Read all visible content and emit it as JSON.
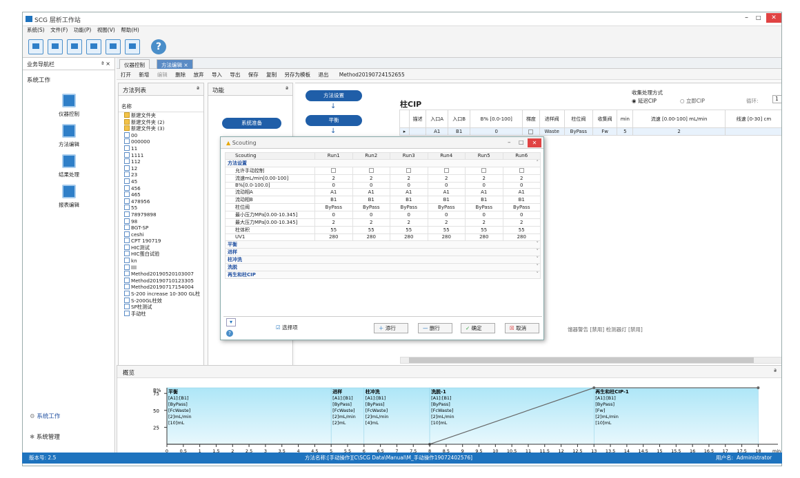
{
  "app": {
    "title": "SCG 层析工作站"
  },
  "menu": [
    "系统(S)",
    "文件(F)",
    "功能(P)",
    "视图(V)",
    "帮助(H)"
  ],
  "nav": {
    "title": "业务导航栏",
    "pin": "ª ×",
    "section": "系统工作",
    "items": [
      "仪器控制",
      "方法编辑",
      "结果处理",
      "报表编辑"
    ],
    "bottom": [
      "系统工作",
      "系统管理"
    ]
  },
  "tabs": [
    "仪器控制",
    "方法编辑"
  ],
  "edtoolbar": [
    "打开",
    "新增",
    "编辑",
    "删除",
    "放弃",
    "导入",
    "导出",
    "保存",
    "复制",
    "另存为模板",
    "退出"
  ],
  "method_name": "Method20190724152655",
  "method_list": {
    "title": "方法列表",
    "col": "名称",
    "items": [
      {
        "t": "新建文件夹",
        "f": true
      },
      {
        "t": "新建文件夹 (2)",
        "f": true
      },
      {
        "t": "新建文件夹 (3)",
        "f": true
      },
      {
        "t": "00"
      },
      {
        "t": "000000"
      },
      {
        "t": "11"
      },
      {
        "t": "1111"
      },
      {
        "t": "112"
      },
      {
        "t": "12"
      },
      {
        "t": "23"
      },
      {
        "t": "45"
      },
      {
        "t": "456"
      },
      {
        "t": "465"
      },
      {
        "t": "478956"
      },
      {
        "t": "55"
      },
      {
        "t": "78979898"
      },
      {
        "t": "98"
      },
      {
        "t": "BGT-SP"
      },
      {
        "t": "ceshi"
      },
      {
        "t": "CPT 190719"
      },
      {
        "t": "HIC测试"
      },
      {
        "t": "HIC蛋白试验"
      },
      {
        "t": "kn"
      },
      {
        "t": "llll"
      },
      {
        "t": "Method20190520103007"
      },
      {
        "t": "Method20190710123305"
      },
      {
        "t": "Method20190717154004"
      },
      {
        "t": "S-200 increase 10-300 GL柱"
      },
      {
        "t": "S-200GL柱效"
      },
      {
        "t": "SP柱测试"
      },
      {
        "t": "手动柱"
      }
    ]
  },
  "func": {
    "title": "功能",
    "sys_prep": "系统准备",
    "steps": [
      "方法设置",
      "平衡"
    ]
  },
  "column_cip": {
    "title": "柱CIP",
    "collect_label": "收集处理方式",
    "opt1": "延迟CIP",
    "opt2": "立即CIP",
    "loop_label": "循环:",
    "loop_value": "1",
    "headers": [
      "描述",
      "入口A",
      "入口B",
      "B% [0.0-100]",
      "梯度",
      "进样阀",
      "柱位阀",
      "收集阀",
      "min",
      "流速 [0.00-100] mL/min",
      "线速 [0-30] cm"
    ],
    "row": [
      "",
      "A1",
      "B1",
      "0",
      "",
      "Waste",
      "ByPass",
      "Fw",
      "5",
      "2",
      ""
    ],
    "detector_text": "馏器警告 [禁用] 检测器灯 [禁用]"
  },
  "scouting": {
    "title": "Scouting",
    "cols": [
      "Scouting",
      "Run1",
      "Run2",
      "Run3",
      "Run4",
      "Run5",
      "Run6"
    ],
    "sec_method": "方法设置",
    "rows": [
      {
        "label": "允许手动控制",
        "vals": [
          "cb",
          "cb",
          "cb",
          "cb",
          "cb",
          "cb"
        ]
      },
      {
        "label": "流速mL/min[0.00-100]",
        "vals": [
          "2",
          "2",
          "2",
          "2",
          "2",
          "2"
        ]
      },
      {
        "label": "B%[0.0-100.0]",
        "vals": [
          "0",
          "0",
          "0",
          "0",
          "0",
          "0"
        ]
      },
      {
        "label": "流动相A",
        "vals": [
          "A1",
          "A1",
          "A1",
          "A1",
          "A1",
          "A1"
        ]
      },
      {
        "label": "流动相B",
        "vals": [
          "B1",
          "B1",
          "B1",
          "B1",
          "B1",
          "B1"
        ]
      },
      {
        "label": "柱位阀",
        "vals": [
          "ByPass",
          "ByPass",
          "ByPass",
          "ByPass",
          "ByPass",
          "ByPass"
        ]
      },
      {
        "label": "最小压力MPa[0.00-10.345]",
        "vals": [
          "0",
          "0",
          "0",
          "0",
          "0",
          "0"
        ]
      },
      {
        "label": "最大压力MPa[0.00-10.345]",
        "vals": [
          "2",
          "2",
          "2",
          "2",
          "2",
          "2"
        ]
      },
      {
        "label": "柱体积",
        "vals": [
          "55",
          "55",
          "55",
          "55",
          "55",
          "55"
        ]
      },
      {
        "label": "UV1",
        "vals": [
          "280",
          "280",
          "280",
          "280",
          "280",
          "280"
        ]
      }
    ],
    "sections": [
      "平衡",
      "进样",
      "柱冲洗",
      "洗脱",
      "再生和柱CIP"
    ],
    "buttons": {
      "select": "选择项",
      "add": "添行",
      "del": "删行",
      "ok": "确定",
      "cancel": "取消"
    }
  },
  "overview": {
    "title": "概览",
    "ylabel": "B%",
    "yticks": [
      "75",
      "50",
      "25"
    ],
    "segments": [
      {
        "name": "平衡",
        "lines": [
          "[A1]:[B1]",
          "[ByPass]",
          "[FcWaste]",
          "[2]mL/min",
          "[10]mL"
        ],
        "x0": 0,
        "x1": 5
      },
      {
        "name": "进样",
        "lines": [
          "[A1]:[B1]",
          "[ByPass]",
          "[FcWaste]",
          "[2]mL/min",
          "[2]mL"
        ],
        "x0": 5,
        "x1": 6
      },
      {
        "name": "柱冲洗",
        "lines": [
          "[A1]:[B1]",
          "[ByPass]",
          "[FcWaste]",
          "[2]mL/min",
          "[4]mL"
        ],
        "x0": 6,
        "x1": 8
      },
      {
        "name": "洗脱-1",
        "lines": [
          "[A1]:[B1]",
          "[ByPass]",
          "[FcWaste]",
          "[2]mL/min",
          "[10]mL"
        ],
        "x0": 8,
        "x1": 13
      },
      {
        "name": "再生和柱CIP-1",
        "lines": [
          "[A1]:[B1]",
          "[ByPass]",
          "[Fw]",
          "[2]mL/min",
          "[10]mL"
        ],
        "x0": 13,
        "x1": 18
      }
    ],
    "xticks": [
      "0",
      "0.5",
      "1",
      "1.5",
      "2",
      "2.5",
      "3",
      "3.5",
      "4",
      "4.5",
      "5",
      "5.5",
      "6",
      "6.5",
      "7",
      "7.5",
      "8",
      "8.5",
      "9",
      "9.5",
      "10",
      "10.5",
      "11",
      "11.5",
      "12",
      "12.5",
      "13",
      "13.5",
      "14",
      "14.5",
      "15",
      "15.5",
      "16",
      "16.5",
      "17",
      "17.5",
      "18"
    ],
    "xunit": "min"
  },
  "status": {
    "version": "版本号: 2.5",
    "method": "方法名称:[手动操作][C\\SCG Data\\Manual\\M_手动操作19072402576]",
    "user_label": "用户名:",
    "user": "Administrator"
  }
}
